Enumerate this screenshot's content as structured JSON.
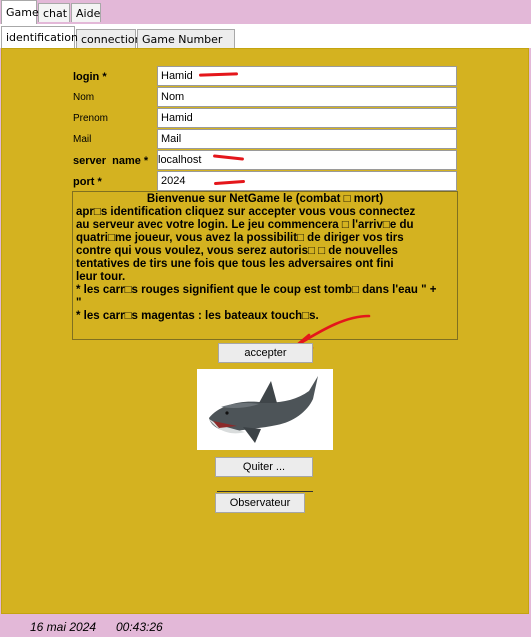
{
  "top_tabs": [
    "Game",
    "chat",
    "Aide"
  ],
  "sub_tabs": [
    "identification",
    "connection",
    "Game Number one"
  ],
  "form": {
    "login": {
      "label": "login *",
      "value": "Hamid"
    },
    "nom": {
      "label": "Nom",
      "value": "Nom"
    },
    "prenom": {
      "label": "Prenom",
      "value": "Hamid"
    },
    "mail": {
      "label": "Mail",
      "value": "Mail"
    },
    "server": {
      "label": "server  name *",
      "value": "localhost"
    },
    "port": {
      "label": "port *",
      "value": "2024"
    }
  },
  "info": {
    "title": "Bienvenue sur NetGame le (combat □ mort)",
    "body": "apr□s identification cliquez sur accepter vous vous connectez\nau serveur avec votre login. Le jeu commencera □ l'arriv□e du\nquatri□me joueur, vous avez la possibilit□ de diriger vos tirs\ncontre qui vous voulez, vous serez autoris□ □ de nouvelles\ntentatives de tirs une fois que tous les adversaires ont fini\nleur tour.\n* les carr□s rouges signifient que le coup est tomb□ dans l'eau \" +\n  \"\n* les carr□s magentas : les bateaux touch□s."
  },
  "buttons": {
    "accept": "accepter",
    "quit": "Quiter ...",
    "observer": "Observateur"
  },
  "status": {
    "date": "16 mai 2024",
    "time": "00:43:26"
  },
  "colors": {
    "panel": "#d4b220",
    "chrome": "#e3b8d8",
    "annotation": "#e4161b"
  },
  "icons": [
    "shark-image",
    "annotation-arrow"
  ]
}
